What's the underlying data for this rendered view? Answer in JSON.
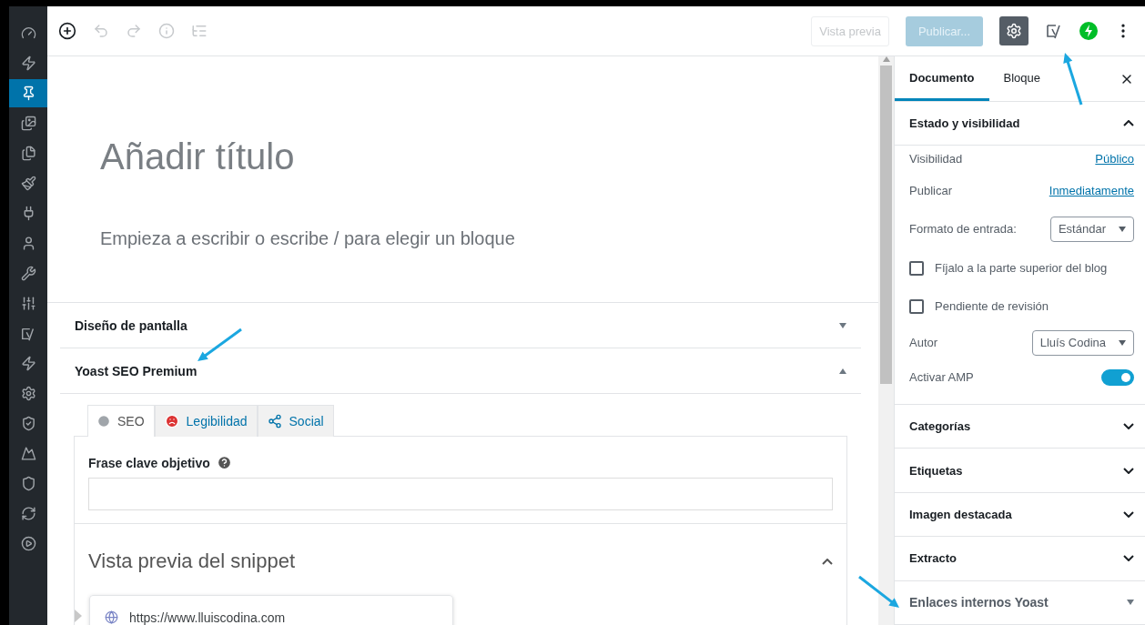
{
  "admin_menu": [
    {
      "selected": false
    },
    {
      "selected": false
    },
    {
      "selected": true
    },
    {
      "selected": false
    },
    {
      "selected": false
    },
    {
      "selected": false
    },
    {
      "selected": false
    },
    {
      "selected": false
    },
    {
      "selected": false
    },
    {
      "selected": false
    },
    {
      "selected": false
    },
    {
      "selected": false
    },
    {
      "selected": false
    },
    {
      "selected": false
    },
    {
      "selected": false
    },
    {
      "selected": false
    },
    {
      "selected": false
    },
    {
      "selected": false
    }
  ],
  "toolbar": {
    "preview_button": "Vista previa",
    "publish_button": {
      "label": "Publicar...",
      "disabled": true
    },
    "settings_selected": true
  },
  "editor": {
    "title_placeholder": "Añadir título",
    "body_placeholder": "Empieza a escribir o escribe / para elegir un bloque"
  },
  "metaboxes": [
    {
      "title": "Diseño de pantalla",
      "expanded": false
    },
    {
      "title": "Yoast SEO Premium",
      "expanded": true
    }
  ],
  "yoast": {
    "tabs": [
      {
        "label": "SEO",
        "selected": true
      },
      {
        "label": "Legibilidad",
        "selected": false
      },
      {
        "label": "Social",
        "selected": false
      }
    ],
    "keyphrase_label": "Frase clave objetivo",
    "snippet_title": "Vista previa del snippet",
    "snippet_expanded": true,
    "snippet_url": "https://www.lluiscodina.com"
  },
  "sidebar": {
    "tabs": [
      {
        "label": "Documento",
        "selected": true
      },
      {
        "label": "Bloque",
        "selected": false
      }
    ],
    "status_panel": {
      "title": "Estado y visibilidad",
      "expanded": true,
      "rows": [
        {
          "kind": "link",
          "label": "Visibilidad",
          "value": "Público"
        },
        {
          "kind": "link",
          "label": "Publicar",
          "value": "Inmediatamente"
        },
        {
          "kind": "select",
          "label": "Formato de entrada:",
          "value": "Estándar"
        },
        {
          "kind": "checkbox",
          "label": "Fíjalo a la parte superior del blog",
          "checked": false
        },
        {
          "kind": "checkbox",
          "label": "Pendiente de revisión",
          "checked": false
        },
        {
          "kind": "select",
          "label": "Autor",
          "value": "Lluís Codina"
        },
        {
          "kind": "toggle",
          "label": "Activar AMP",
          "on": true
        }
      ]
    },
    "panels": [
      {
        "title": "Categorías",
        "kind": "core",
        "expanded": false
      },
      {
        "title": "Etiquetas",
        "kind": "core",
        "expanded": false
      },
      {
        "title": "Imagen destacada",
        "kind": "core",
        "expanded": false
      },
      {
        "title": "Extracto",
        "kind": "core",
        "expanded": false
      },
      {
        "title": "Enlaces internos Yoast",
        "kind": "plugin",
        "expanded": false
      }
    ]
  }
}
